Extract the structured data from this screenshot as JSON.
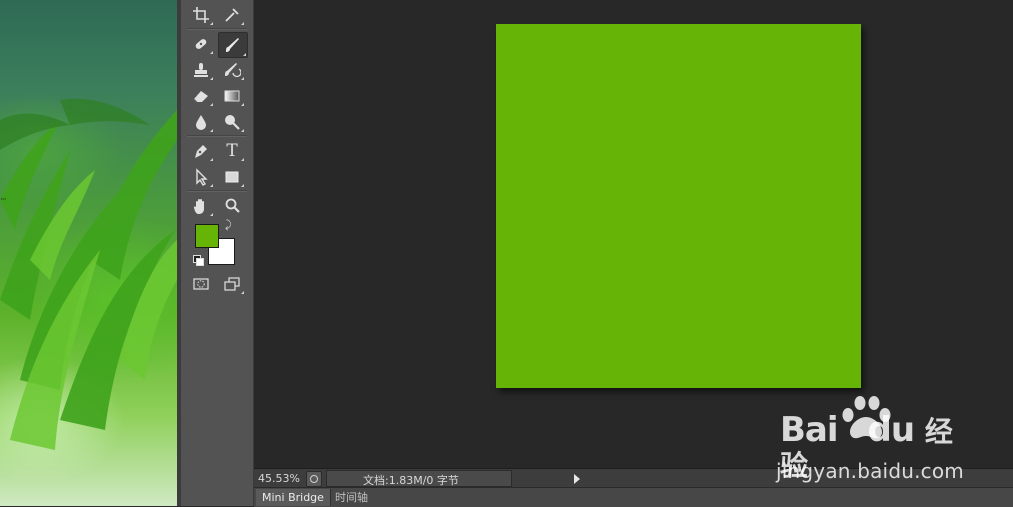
{
  "document": {
    "fill_color": "#65b406"
  },
  "colors": {
    "foreground": "#65b406",
    "background": "#ffffff"
  },
  "status_bar": {
    "zoom": "45.53%",
    "doc_info": "文档:1.83M/0 字节"
  },
  "bottom_tabs": [
    "Mini Bridge",
    "时间轴"
  ],
  "tools": [
    "crop-icon",
    "eyedropper-icon",
    "spot-healing-icon",
    "brush-icon",
    "clone-stamp-icon",
    "history-brush-icon",
    "eraser-icon",
    "gradient-icon",
    "blur-icon",
    "dodge-icon",
    "pen-icon",
    "type-icon",
    "path-selection-icon",
    "rectangle-icon",
    "hand-icon",
    "zoom-icon",
    "quick-mask-icon",
    "screen-mode-icon"
  ],
  "type_tool_glyph": "T",
  "watermark": {
    "logo_text": "Bai",
    "logo_text_2": "du",
    "logo_cn": "经验",
    "url": "jingyan.baidu.com"
  }
}
